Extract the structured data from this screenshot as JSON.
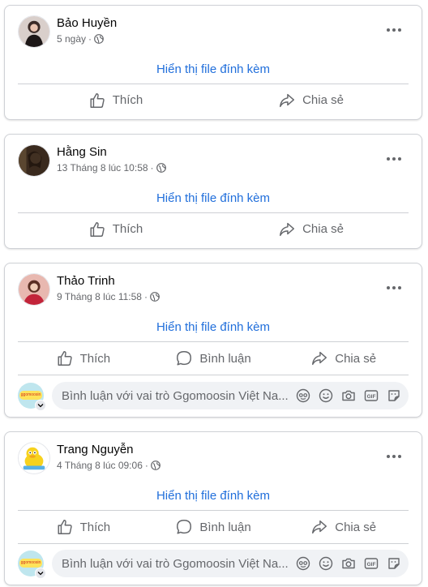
{
  "posts": [
    {
      "author": "Bảo Huyền",
      "time": "5 ngày",
      "separator": "·",
      "attachment": "Hiển thị file đính kèm",
      "like": "Thích",
      "share": "Chia sẻ"
    },
    {
      "author": "Hằng Sin",
      "time": "13 Tháng 8 lúc 10:58",
      "separator": "·",
      "attachment": "Hiển thị file đính kèm",
      "like": "Thích",
      "share": "Chia sẻ"
    },
    {
      "author": "Thảo Trinh",
      "time": "9 Tháng 8 lúc 11:58",
      "separator": "·",
      "attachment": "Hiển thị file đính kèm",
      "like": "Thích",
      "comment": "Bình luận",
      "share": "Chia sẻ",
      "comment_placeholder": "Bình luận với vai trò Ggomoosin Việt Na..."
    },
    {
      "author": "Trang Nguyễn",
      "time": "4 Tháng 8 lúc 09:06",
      "separator": "·",
      "attachment": "Hiển thị file đính kèm",
      "like": "Thích",
      "comment": "Bình luận",
      "share": "Chia sẻ",
      "comment_placeholder": "Bình luận với vai trò Ggomoosin Việt Na..."
    }
  ],
  "page_avatar_logo": "ggomoosin",
  "colors": {
    "link": "#216fdb",
    "secondary_text": "#65676b",
    "divider": "#ced0d4",
    "comment_bg": "#f0f2f5"
  },
  "icons": [
    "globe-icon",
    "more-icon",
    "like-icon",
    "comment-icon",
    "share-icon",
    "avatar-sticker-icon",
    "emoji-icon",
    "camera-icon",
    "gif-icon",
    "sticker-icon"
  ]
}
